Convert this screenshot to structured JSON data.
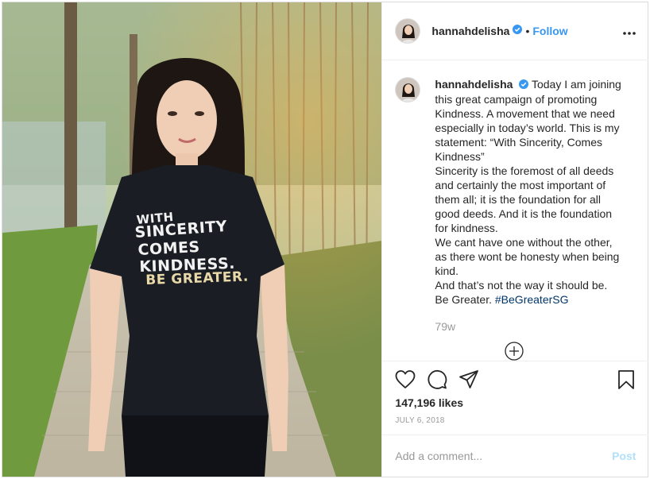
{
  "post": {
    "username": "hannahdelisha",
    "follow_label": "Follow",
    "separator": "•",
    "shirt_text": [
      "WITH",
      "SINCERITY",
      "COMES",
      "KINDNESS.",
      "BE GREATER."
    ],
    "caption_lines": [
      "Today I am joining",
      "this great campaign of promoting",
      "Kindness. A movement that we need",
      "especially in today’s world. This is my",
      "statement: “With Sincerity, Comes",
      "Kindness”",
      "Sincerity is the foremost of all deeds",
      "and certainly the most important of",
      "them all; it is the foundation for all",
      "good deeds. And it is the foundation",
      "for kindness.",
      "We cant have one without the other,",
      "as there wont be honesty when being",
      "kind.",
      "And that’s not the way it should be.",
      "Be Greater."
    ],
    "hashtag": "#BeGreaterSG",
    "time_ago": "79w",
    "likes": "147,196 likes",
    "date": "JULY 6, 2018",
    "comment_placeholder": "Add a comment...",
    "post_label": "Post"
  },
  "colors": {
    "link_blue": "#3897f0",
    "hashtag_blue": "#003569",
    "muted_gray": "#999999",
    "post_disabled": "#b2dffc",
    "border": "#efefef"
  },
  "icons": [
    "verified-badge-icon",
    "more-options-icon",
    "load-more-comments-icon",
    "heart-icon",
    "comment-icon",
    "share-icon",
    "bookmark-icon"
  ]
}
